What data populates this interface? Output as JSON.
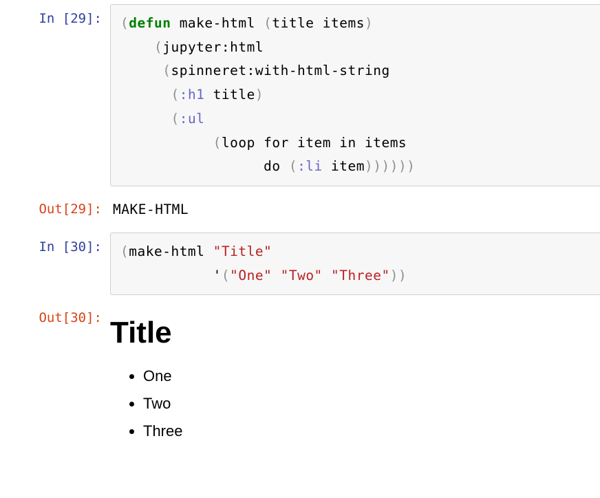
{
  "cells": {
    "c0": {
      "kind": "in",
      "prompt": "In [29]:",
      "tokens": [
        {
          "t": "(",
          "c": "tok-paren"
        },
        {
          "t": "defun",
          "c": "tok-keyword"
        },
        {
          "t": " make-html ",
          "c": "tok-plain"
        },
        {
          "t": "(",
          "c": "tok-paren"
        },
        {
          "t": "title items",
          "c": "tok-plain"
        },
        {
          "t": ")",
          "c": "tok-paren"
        },
        {
          "t": "\n    ",
          "c": "tok-plain"
        },
        {
          "t": "(",
          "c": "tok-paren"
        },
        {
          "t": "jupyter:html",
          "c": "tok-plain"
        },
        {
          "t": "\n     ",
          "c": "tok-plain"
        },
        {
          "t": "(",
          "c": "tok-paren"
        },
        {
          "t": "spinneret:with-html-string",
          "c": "tok-plain"
        },
        {
          "t": "\n      ",
          "c": "tok-plain"
        },
        {
          "t": "(",
          "c": "tok-paren"
        },
        {
          "t": ":h1",
          "c": "tok-kw-sym"
        },
        {
          "t": " title",
          "c": "tok-plain"
        },
        {
          "t": ")",
          "c": "tok-paren"
        },
        {
          "t": "\n      ",
          "c": "tok-plain"
        },
        {
          "t": "(",
          "c": "tok-paren"
        },
        {
          "t": ":ul",
          "c": "tok-kw-sym"
        },
        {
          "t": "\n           ",
          "c": "tok-plain"
        },
        {
          "t": "(",
          "c": "tok-paren"
        },
        {
          "t": "loop for item in items",
          "c": "tok-plain"
        },
        {
          "t": "\n                 do ",
          "c": "tok-plain"
        },
        {
          "t": "(",
          "c": "tok-paren"
        },
        {
          "t": ":li",
          "c": "tok-kw-sym"
        },
        {
          "t": " item",
          "c": "tok-plain"
        },
        {
          "t": ")",
          "c": "tok-paren"
        },
        {
          "t": ")",
          "c": "tok-paren"
        },
        {
          "t": ")",
          "c": "tok-paren"
        },
        {
          "t": ")",
          "c": "tok-paren"
        },
        {
          "t": ")",
          "c": "tok-paren"
        },
        {
          "t": ")",
          "c": "tok-paren"
        }
      ]
    },
    "c1": {
      "kind": "out",
      "prompt": "Out[29]:",
      "text": "MAKE-HTML"
    },
    "c2": {
      "kind": "in",
      "prompt": "In [30]:",
      "tokens": [
        {
          "t": "(",
          "c": "tok-paren"
        },
        {
          "t": "make-html ",
          "c": "tok-plain"
        },
        {
          "t": "\"Title\"",
          "c": "tok-string"
        },
        {
          "t": "\n           '",
          "c": "tok-plain"
        },
        {
          "t": "(",
          "c": "tok-paren"
        },
        {
          "t": "\"One\"",
          "c": "tok-string"
        },
        {
          "t": " ",
          "c": "tok-plain"
        },
        {
          "t": "\"Two\"",
          "c": "tok-string"
        },
        {
          "t": " ",
          "c": "tok-plain"
        },
        {
          "t": "\"Three\"",
          "c": "tok-string"
        },
        {
          "t": ")",
          "c": "tok-paren"
        },
        {
          "t": ")",
          "c": "tok-paren"
        }
      ]
    },
    "c3": {
      "kind": "out-html",
      "prompt": "Out[30]:",
      "html": {
        "title": "Title",
        "items": [
          "One",
          "Two",
          "Three"
        ]
      }
    }
  }
}
